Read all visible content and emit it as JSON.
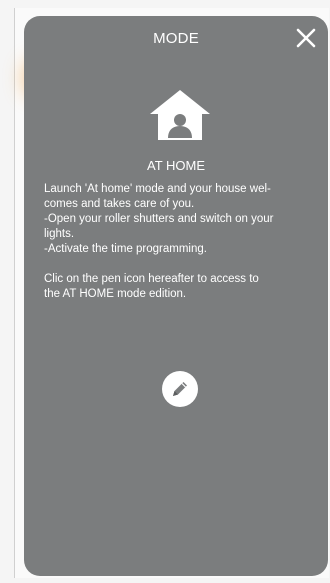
{
  "modal": {
    "title": "MODE",
    "close_icon": "close-icon",
    "mode_icon": "home-user-icon",
    "mode_name": "AT HOME",
    "description": {
      "line1": "Launch 'At home' mode and your house wel-",
      "line2": "comes and takes care of you.",
      "line3": "-Open your roller shutters and switch on your",
      "line4": "lights.",
      "line5": "-Activate the time programming.",
      "line6": "Clic on the pen icon hereafter to access to",
      "line7": "the AT HOME mode edition."
    },
    "edit_icon": "pen-icon"
  },
  "colors": {
    "overlay": "#7b7d7e",
    "text": "#ffffff",
    "background_accent": "#f0a030"
  }
}
